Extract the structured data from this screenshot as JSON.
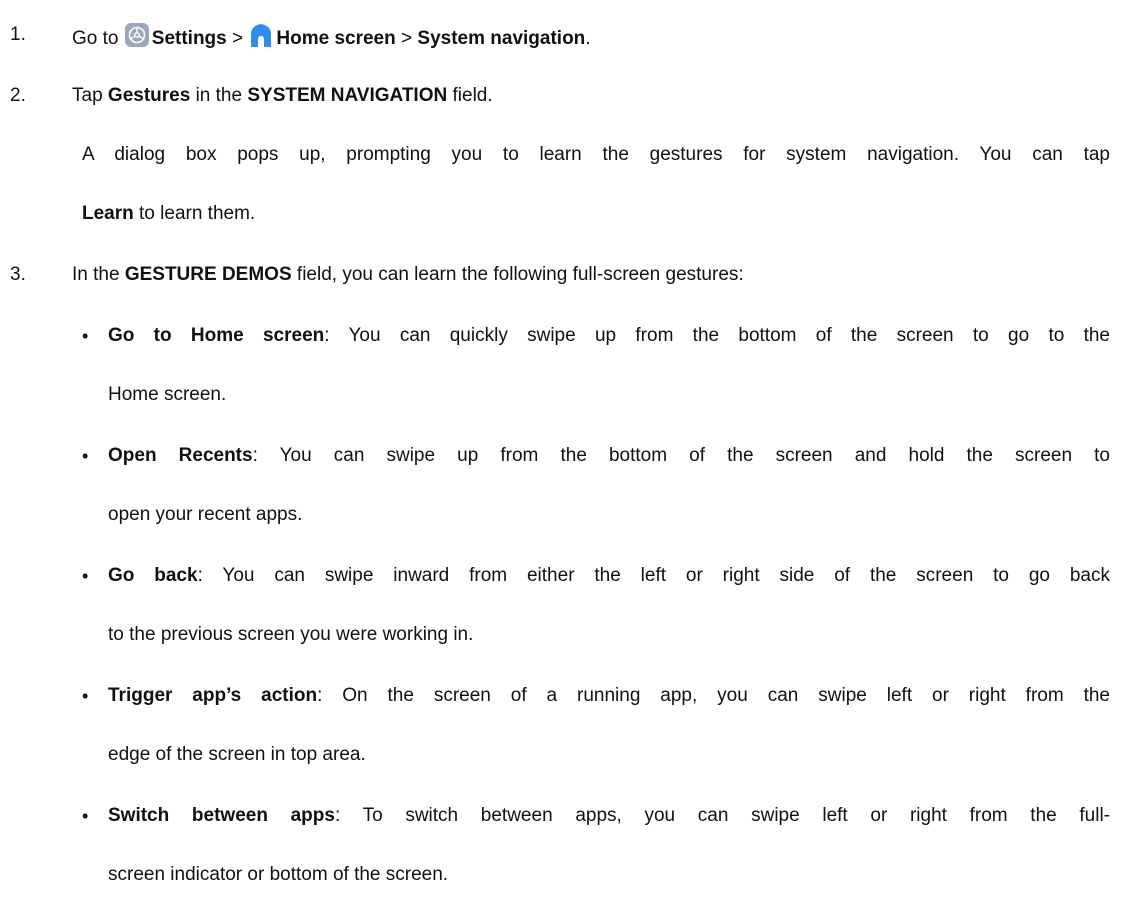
{
  "steps": [
    {
      "num": "1.",
      "go_to": "Go to",
      "settings": "Settings",
      "sep1": ">",
      "home_screen": "Home screen",
      "sep2": ">",
      "system_navigation": "System navigation",
      "end": "."
    },
    {
      "num": "2.",
      "tap": "Tap",
      "gestures": "Gestures",
      "in_the": "in the",
      "field_name": "SYSTEM NAVIGATION",
      "field": "field.",
      "para_line1": "A dialog box pops up, prompting you to learn the gestures for system navigation. You can tap",
      "learn": "Learn",
      "para_line2_rest": "to learn them."
    },
    {
      "num": "3.",
      "in_the": "In the",
      "field_name": "GESTURE DEMOS",
      "rest": "field, you can learn the following full-screen gestures:"
    }
  ],
  "bullets": [
    {
      "bullet": "•",
      "title": "Go to Home screen",
      "line1": ": You can quickly swipe up from the bottom of the screen to go to the",
      "line2": "Home screen."
    },
    {
      "bullet": "•",
      "title": "Open Recents",
      "line1": ": You can swipe up from the bottom of the screen and hold the screen to",
      "line2": "open your recent apps."
    },
    {
      "bullet": "•",
      "title": "Go back",
      "line1": ": You can swipe inward from either the left or right side of the screen to go back",
      "line2": "to the previous screen you were working in."
    },
    {
      "bullet": "•",
      "title": "Trigger app’s action",
      "line1": ": On the screen of a running app, you can swipe left or right from the",
      "line2": "edge of the screen in top area."
    },
    {
      "bullet": "•",
      "title": "Switch between apps",
      "line1": ": To switch between apps, you can swipe left or right from the full-",
      "line2": "screen indicator or bottom of the screen."
    }
  ],
  "icons": {
    "settings": "gear-icon",
    "home": "home-icon"
  },
  "colors": {
    "text": "#111111",
    "settings_icon_bg": "#9aa7bd",
    "home_icon": "#2f8df0"
  }
}
